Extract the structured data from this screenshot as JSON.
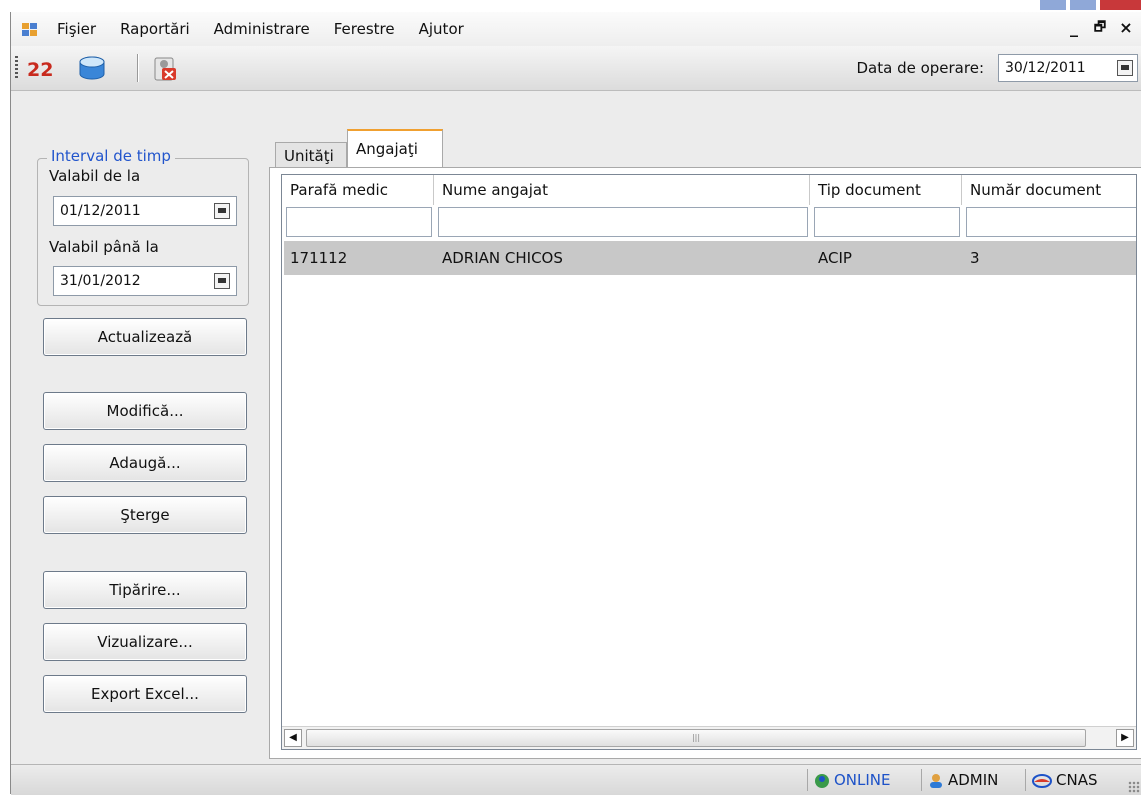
{
  "menu": {
    "items": [
      "Fişier",
      "Raportări",
      "Administrare",
      "Ferestre",
      "Ajutor"
    ],
    "mdi_minimize": "_",
    "mdi_restore": "🗗",
    "mdi_close": "×"
  },
  "toolbar": {
    "buttons": [
      "calendar-22-icon",
      "database-icon",
      "user-remove-icon"
    ],
    "operation_date_label": "Data de operare:",
    "operation_date": "30/12/2011"
  },
  "filters": {
    "group_title": "Interval de timp",
    "valid_from_label": "Valabil de la",
    "valid_from": "01/12/2011",
    "valid_to_label": "Valabil până la",
    "valid_to": "31/01/2012"
  },
  "buttons": {
    "refresh": "Actualizează",
    "modify": "Modifică...",
    "add": "Adaugă...",
    "delete": "Şterge",
    "print": "Tipărire...",
    "preview": "Vizualizare...",
    "export": "Export Excel..."
  },
  "tabs": [
    "Unităţi",
    "Angajaţi"
  ],
  "active_tab": "Angajaţi",
  "grid": {
    "columns": [
      "Parafă medic",
      "Nume angajat",
      "Tip document",
      "Număr document"
    ],
    "rows": [
      [
        "171112",
        "ADRIAN CHICOS",
        "ACIP",
        "3"
      ]
    ]
  },
  "status": {
    "connection": "ONLINE",
    "user": "ADMIN",
    "org": "CNAS"
  },
  "colors": {
    "accent_blue": "#2255cc",
    "active_tab_border": "#f0a030",
    "selected_row": "#c8c8c8"
  }
}
